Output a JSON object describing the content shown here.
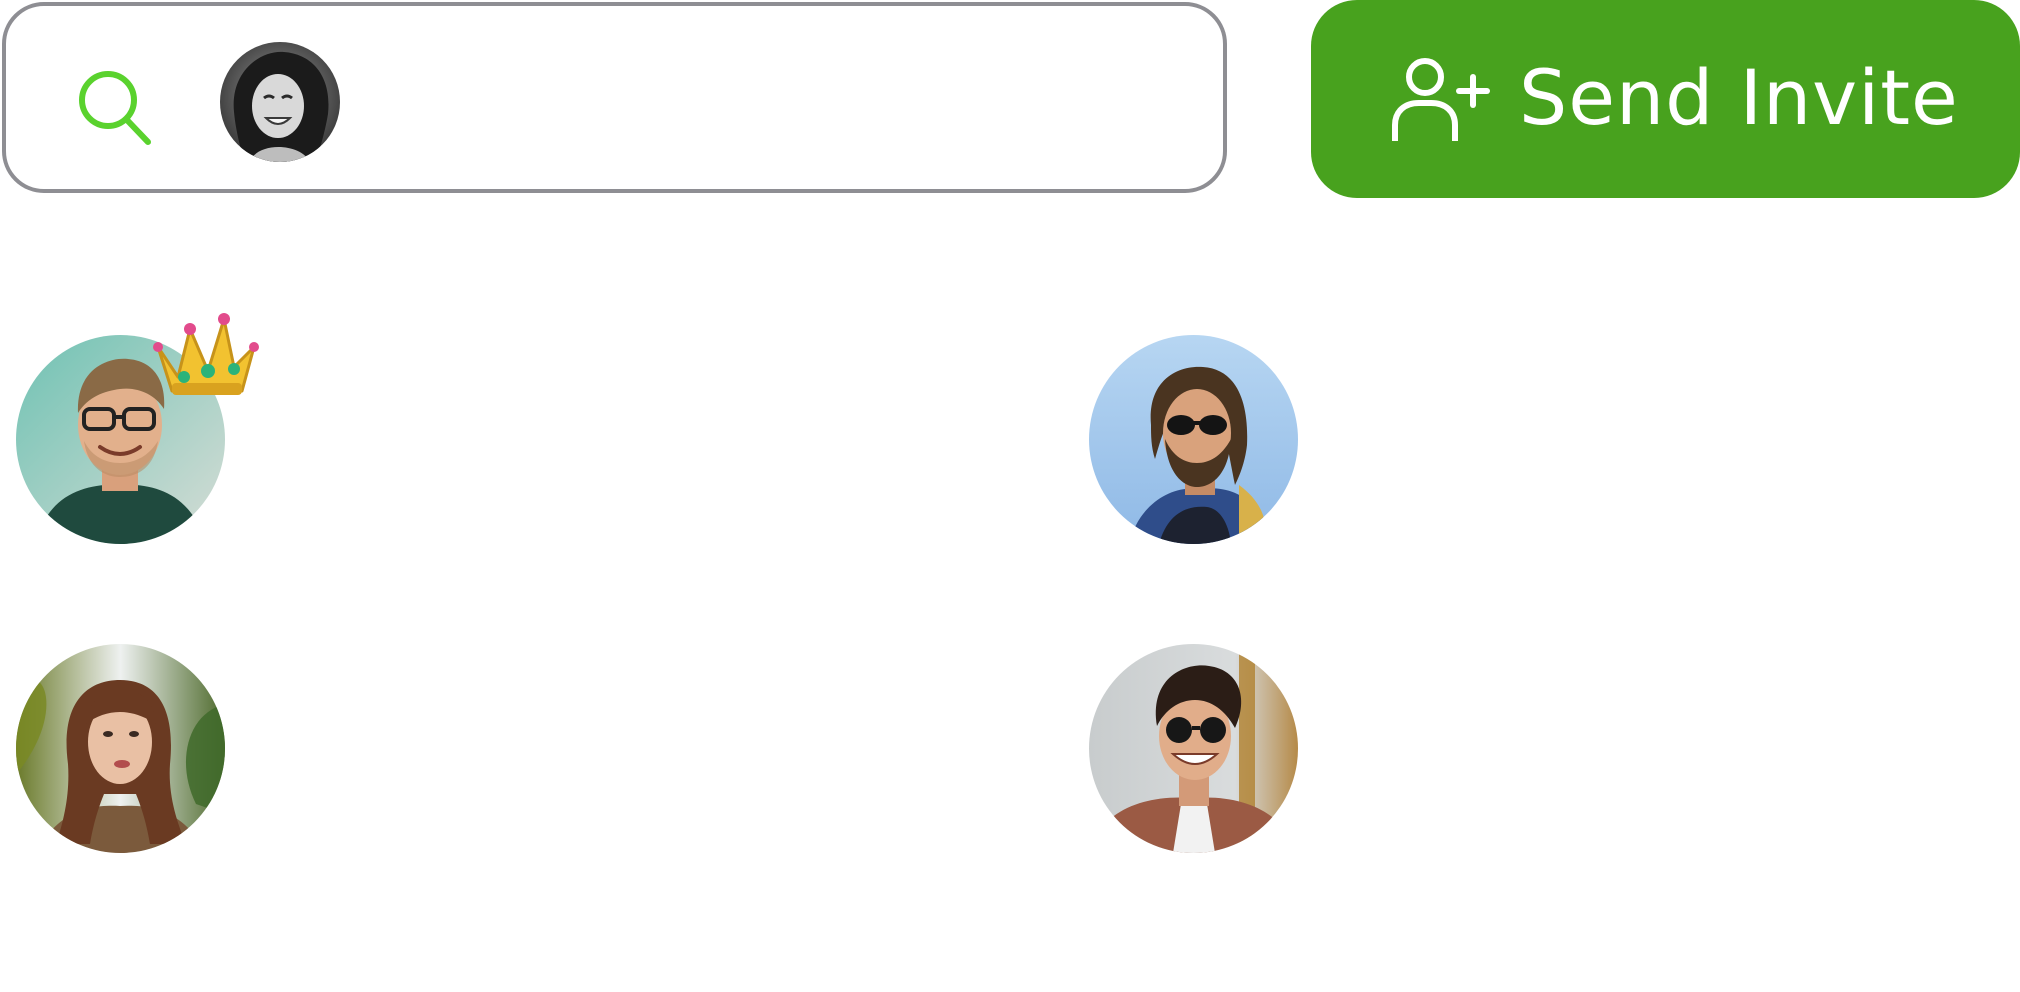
{
  "search": {
    "value": "",
    "placeholder": "",
    "icon": "search-icon",
    "icon_color": "#5ad22e",
    "selected_avatar": {
      "icon": "avatar",
      "description_tone": "monochrome"
    }
  },
  "invite_button": {
    "label": "Send Invite",
    "icon": "add-user-icon",
    "background": "#48a21e",
    "text_color": "#ffffff"
  },
  "members": [
    {
      "icon": "avatar",
      "badge": "crown-icon",
      "is_admin": true
    },
    {
      "icon": "avatar",
      "badge": null,
      "is_admin": false
    },
    {
      "icon": "avatar",
      "badge": null,
      "is_admin": false
    },
    {
      "icon": "avatar",
      "badge": null,
      "is_admin": false
    }
  ],
  "colors": {
    "search_border": "#8e8e93",
    "accent": "#48a21e",
    "search_icon": "#5ad22e"
  }
}
